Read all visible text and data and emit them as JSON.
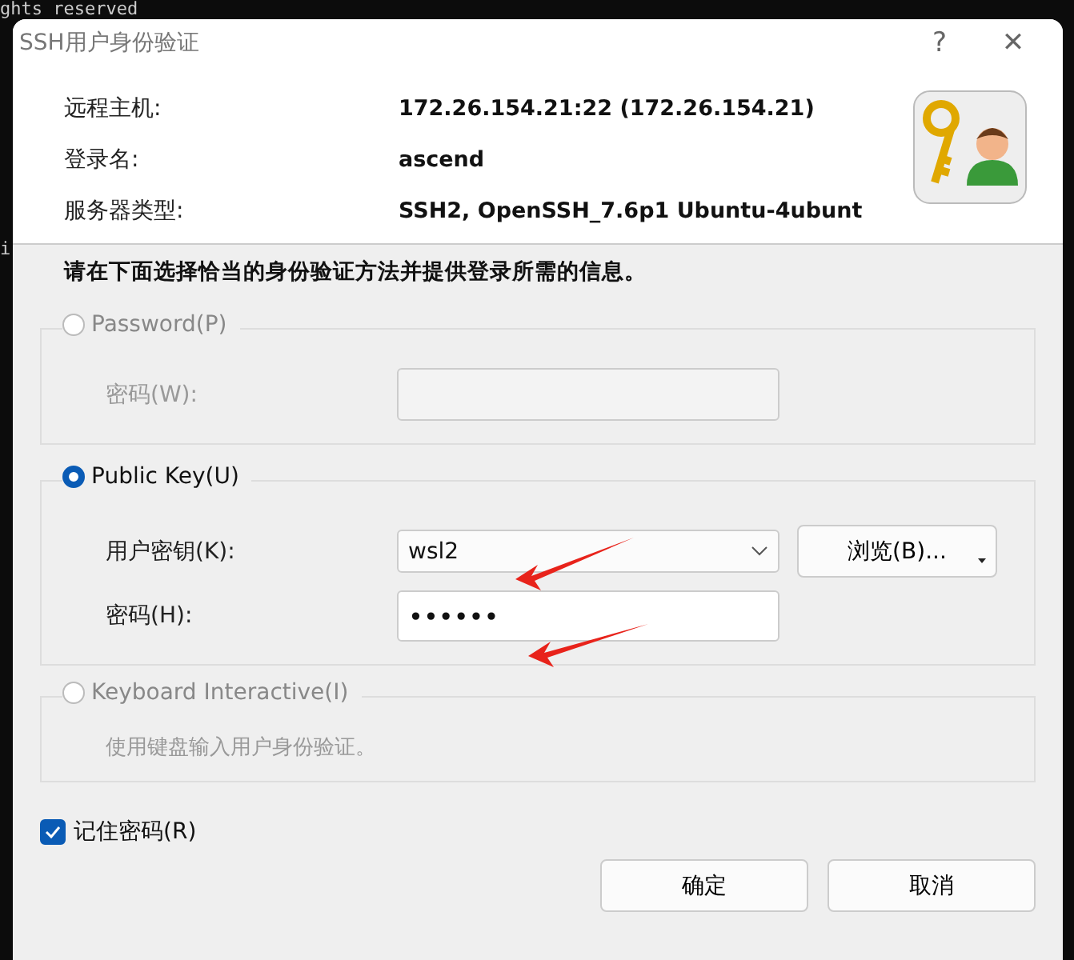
{
  "background": {
    "terminal_lines": [
      "ghts reserved",
      "i"
    ]
  },
  "window": {
    "title": "SSH用户身份验证",
    "help": "?",
    "close": "✕"
  },
  "host_info": [
    {
      "label": "远程主机:",
      "value": "172.26.154.21:22 (172.26.154.21)"
    },
    {
      "label": "登录名:",
      "value": "ascend"
    },
    {
      "label": "服务器类型:",
      "value": "SSH2, OpenSSH_7.6p1 Ubuntu-4ubunt"
    }
  ],
  "instruction": "请在下面选择恰当的身份验证方法并提供登录所需的信息。",
  "methods": [
    {
      "kind": "password",
      "label": "Password(P)",
      "selected": false,
      "disabled": true,
      "field_label": "密码(W):"
    },
    {
      "kind": "publickey",
      "label": "Public Key(U)",
      "selected": true,
      "disabled": false,
      "key_label": "用户密钥(K):",
      "key_value": "wsl2",
      "browse": "浏览(B)...",
      "passphrase_label": "密码(H):",
      "passphrase_value": "••••••"
    },
    {
      "kind": "keyboard",
      "label": "Keyboard Interactive(I)",
      "selected": false,
      "disabled": true,
      "description": "使用键盘输入用户身份验证。"
    }
  ],
  "remember": {
    "label": "记住密码(R)",
    "checked": true
  },
  "buttons": [
    {
      "label": "确定"
    },
    {
      "label": "取消"
    }
  ]
}
